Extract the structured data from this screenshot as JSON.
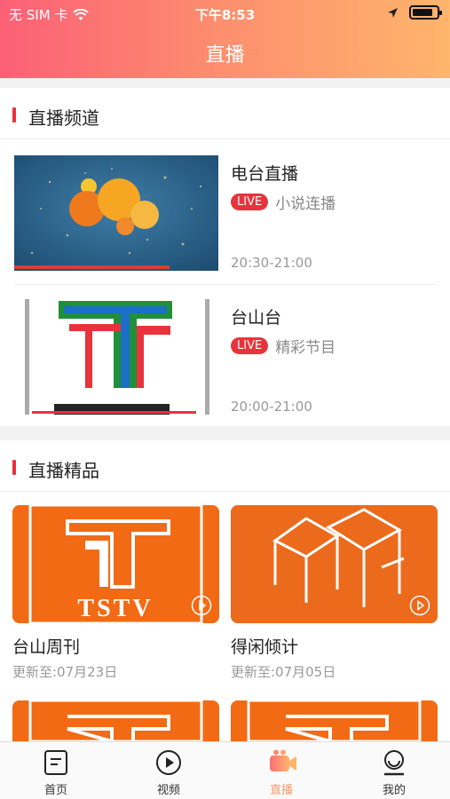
{
  "status_bar": {
    "carrier": "无 SIM 卡",
    "time": "下午8:53"
  },
  "header": {
    "title": "直播"
  },
  "live_channels": {
    "title": "直播频道",
    "items": [
      {
        "name": "电台直播",
        "badge": "LIVE",
        "program": "小说连播",
        "time": "20:30-21:00",
        "thumb_icon": "radio-station-image"
      },
      {
        "name": "台山台",
        "badge": "LIVE",
        "program": "精彩节目",
        "time": "20:00-21:00",
        "thumb_icon": "tstv-logo-image"
      }
    ]
  },
  "live_featured": {
    "title": "直播精品",
    "items": [
      {
        "name": "台山周刊",
        "updated": "更新至:07月23日",
        "cover_text": "TSTV"
      },
      {
        "name": "得闲倾计",
        "updated": "更新至:07月05日"
      }
    ]
  },
  "tabbar": {
    "items": [
      {
        "label": "首页",
        "icon": "document-icon"
      },
      {
        "label": "视频",
        "icon": "play-circle-icon"
      },
      {
        "label": "直播",
        "icon": "video-camera-icon",
        "active": true
      },
      {
        "label": "我的",
        "icon": "user-icon"
      }
    ]
  },
  "colors": {
    "accent": "#e8333c",
    "header_start": "#fc6076",
    "header_end": "#ffb56c",
    "card_orange": "#f26a13"
  }
}
